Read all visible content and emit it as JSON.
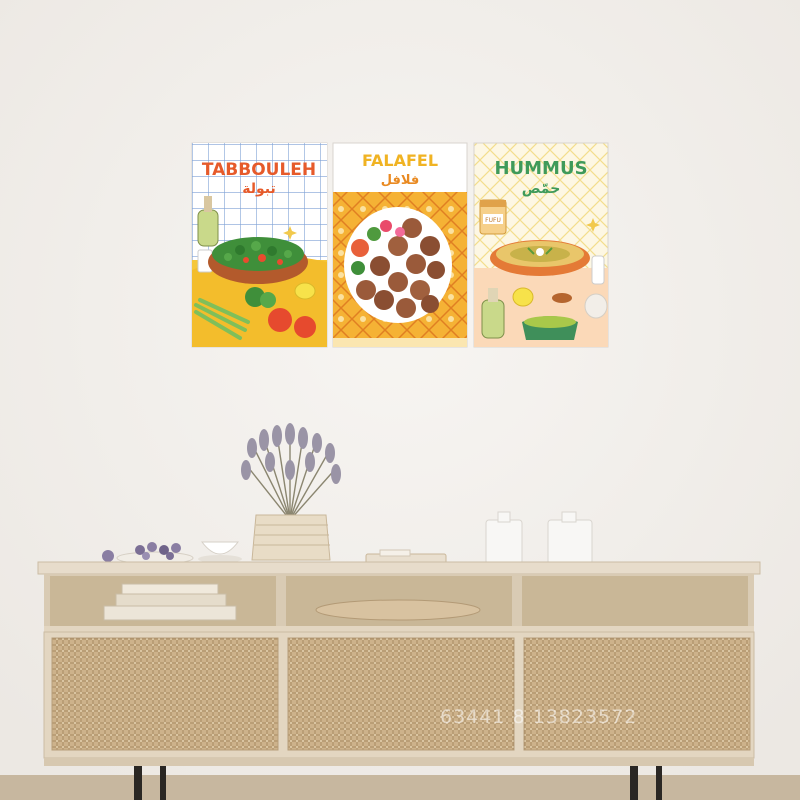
{
  "posters": [
    {
      "title": "TABBOULEH",
      "subtitle": "تبولة",
      "title_color": "#e65a2a",
      "sub_color": "#e65a2a"
    },
    {
      "title": "FALAFEL",
      "subtitle": "فلافل",
      "title_color": "#f0b323",
      "sub_color": "#e98a22"
    },
    {
      "title": "HUMMUS",
      "subtitle": "حمّص",
      "title_color": "#3f9a5a",
      "sub_color": "#3f9a5a"
    }
  ],
  "jar_label": "FUFU",
  "watermark": "63441 8 13823572",
  "colors": {
    "wall": "#f2efec",
    "wood": "#dccdb6",
    "rattan": "#c8ab84",
    "orange": "#e65a2a",
    "yellow": "#f0b323",
    "green": "#3f9a5a"
  }
}
